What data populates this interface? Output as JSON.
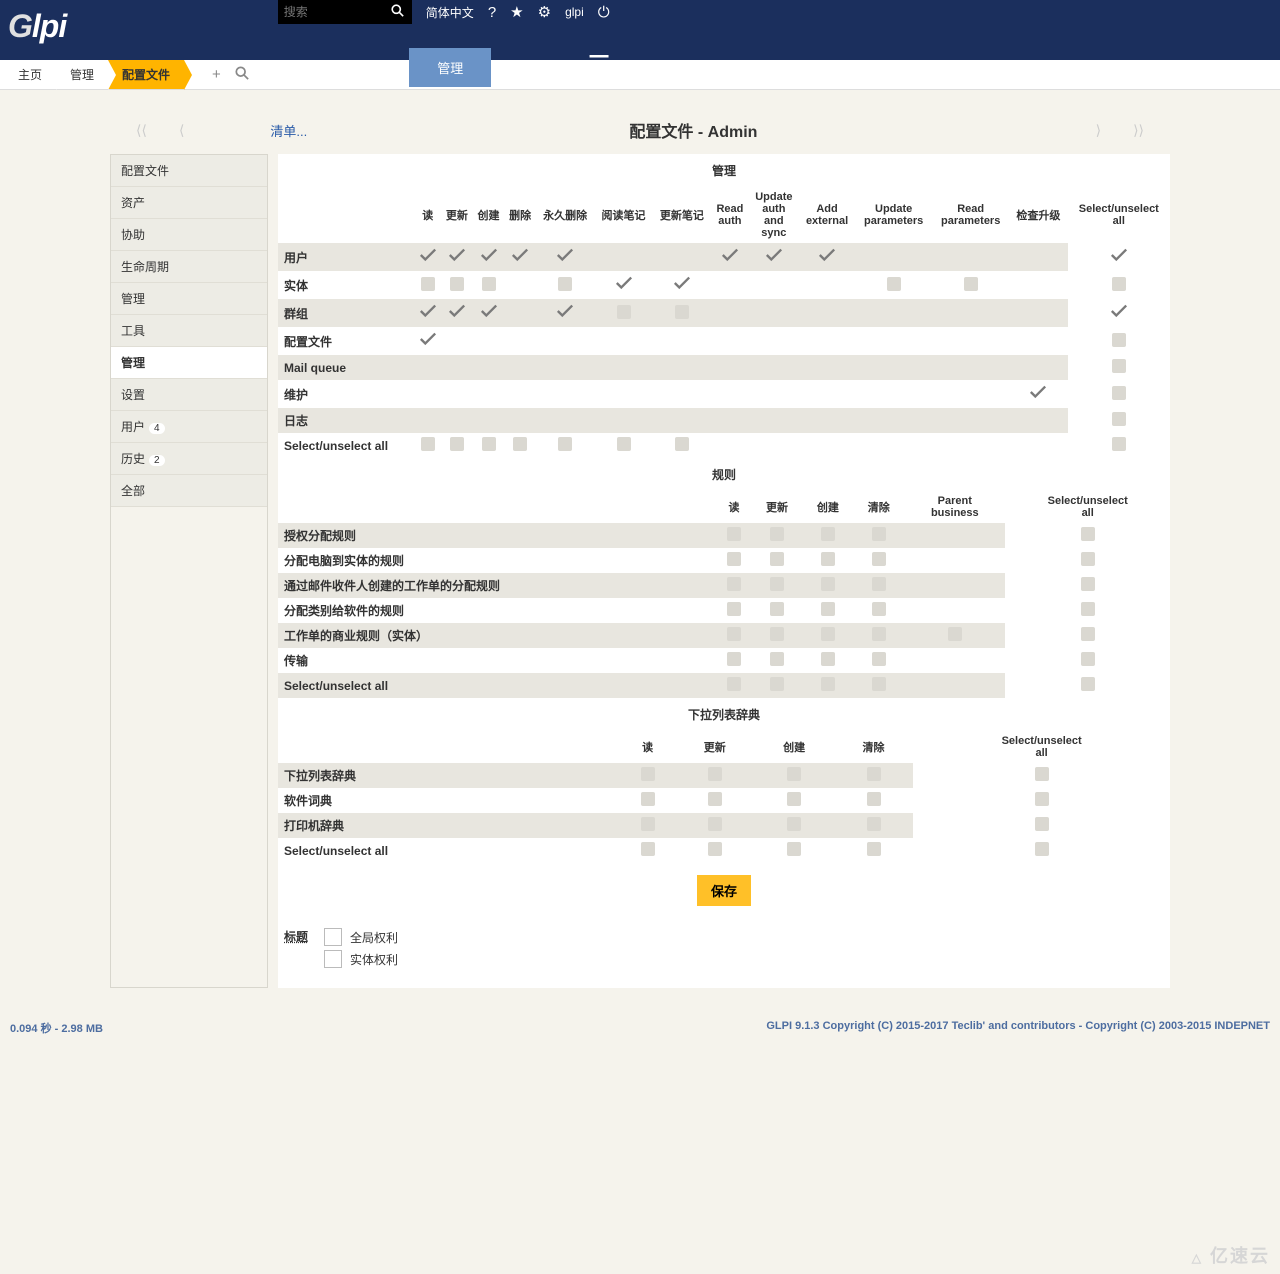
{
  "logo": "Glpi",
  "search_placeholder": "搜索",
  "top_lang": "简体中文",
  "top_user": "glpi",
  "nav": [
    "资产",
    "协助",
    "管理",
    "工具",
    "管理",
    "设置"
  ],
  "nav_active_index": 4,
  "breadcrumb": [
    "主页",
    "管理",
    "配置文件"
  ],
  "list_link": "清单...",
  "page_title": "配置文件 - Admin",
  "sidebar": [
    {
      "label": "配置文件"
    },
    {
      "label": "资产"
    },
    {
      "label": "协助"
    },
    {
      "label": "生命周期"
    },
    {
      "label": "管理"
    },
    {
      "label": "工具"
    },
    {
      "label": "管理",
      "active": true
    },
    {
      "label": "设置"
    },
    {
      "label": "用户",
      "badge": "4"
    },
    {
      "label": "历史",
      "badge": "2"
    },
    {
      "label": "全部"
    }
  ],
  "section1": {
    "title": "管理",
    "cols": [
      "读",
      "更新",
      "创建",
      "删除",
      "永久删除",
      "阅读笔记",
      "更新笔记",
      "Read auth",
      "Update auth and sync",
      "Add external",
      "Update parameters",
      "Read parameters",
      "检查升级",
      "Select/unselect all"
    ],
    "rows": [
      {
        "label": "用户",
        "cells": [
          "c",
          "c",
          "c",
          "c",
          "c",
          "",
          "",
          "c",
          "c",
          "c",
          "",
          "",
          "",
          "c"
        ]
      },
      {
        "label": "实体",
        "cells": [
          "b",
          "b",
          "b",
          "",
          "b",
          "c",
          "c",
          "",
          "",
          "",
          "b",
          "b",
          "",
          "b"
        ]
      },
      {
        "label": "群组",
        "cells": [
          "c",
          "c",
          "c",
          "",
          "c",
          "b",
          "b",
          "",
          "",
          "",
          "",
          "",
          "",
          "c"
        ]
      },
      {
        "label": "配置文件",
        "cells": [
          "c",
          "",
          "",
          "",
          "",
          "",
          "",
          "",
          "",
          "",
          "",
          "",
          "",
          "b"
        ]
      },
      {
        "label": "Mail queue",
        "cells": [
          "",
          "",
          "",
          "",
          "",
          "",
          "",
          "",
          "",
          "",
          "",
          "",
          "",
          "b"
        ]
      },
      {
        "label": "维护",
        "cells": [
          "",
          "",
          "",
          "",
          "",
          "",
          "",
          "",
          "",
          "",
          "",
          "",
          "c",
          "b"
        ]
      },
      {
        "label": "日志",
        "cells": [
          "",
          "",
          "",
          "",
          "",
          "",
          "",
          "",
          "",
          "",
          "",
          "",
          "",
          "b"
        ]
      },
      {
        "label": "Select/unselect all",
        "cells": [
          "b",
          "b",
          "b",
          "b",
          "b",
          "b",
          "b",
          "",
          "",
          "",
          "",
          "",
          "",
          "b"
        ]
      }
    ]
  },
  "section2": {
    "title": "规则",
    "cols": [
      "读",
      "更新",
      "创建",
      "清除",
      "Parent business",
      "Select/unselect all"
    ],
    "rows": [
      {
        "label": "授权分配规则",
        "cells": [
          "b",
          "b",
          "b",
          "b",
          "",
          "b"
        ]
      },
      {
        "label": "分配电脑到实体的规则",
        "cells": [
          "b",
          "b",
          "b",
          "b",
          "",
          "b"
        ]
      },
      {
        "label": "通过邮件收件人创建的工作单的分配规则",
        "cells": [
          "b",
          "b",
          "b",
          "b",
          "",
          "b"
        ]
      },
      {
        "label": "分配类别给软件的规则",
        "cells": [
          "b",
          "b",
          "b",
          "b",
          "",
          "b"
        ]
      },
      {
        "label": "工作单的商业规则（实体）",
        "cells": [
          "b",
          "b",
          "b",
          "b",
          "b",
          "b"
        ]
      },
      {
        "label": "传输",
        "cells": [
          "b",
          "b",
          "b",
          "b",
          "",
          "b"
        ]
      },
      {
        "label": "Select/unselect all",
        "cells": [
          "b",
          "b",
          "b",
          "b",
          "",
          "b"
        ]
      }
    ]
  },
  "section3": {
    "title": "下拉列表辞典",
    "cols": [
      "读",
      "更新",
      "创建",
      "清除",
      "Select/unselect all"
    ],
    "rows": [
      {
        "label": "下拉列表辞典",
        "cells": [
          "b",
          "b",
          "b",
          "b",
          "b"
        ]
      },
      {
        "label": "软件词典",
        "cells": [
          "b",
          "b",
          "b",
          "b",
          "b"
        ]
      },
      {
        "label": "打印机辞典",
        "cells": [
          "b",
          "b",
          "b",
          "b",
          "b"
        ]
      },
      {
        "label": "Select/unselect all",
        "cells": [
          "b",
          "b",
          "b",
          "b",
          "b"
        ]
      }
    ]
  },
  "save_label": "保存",
  "legend_title": "标题",
  "legend_items": [
    "全局权利",
    "实体权利"
  ],
  "footer_left": "0.094 秒 - 2.98 MB",
  "footer_right": "GLPI 9.1.3 Copyright (C) 2015-2017 Teclib' and contributors - Copyright (C) 2003-2015 INDEPNET",
  "watermark": "亿速云"
}
